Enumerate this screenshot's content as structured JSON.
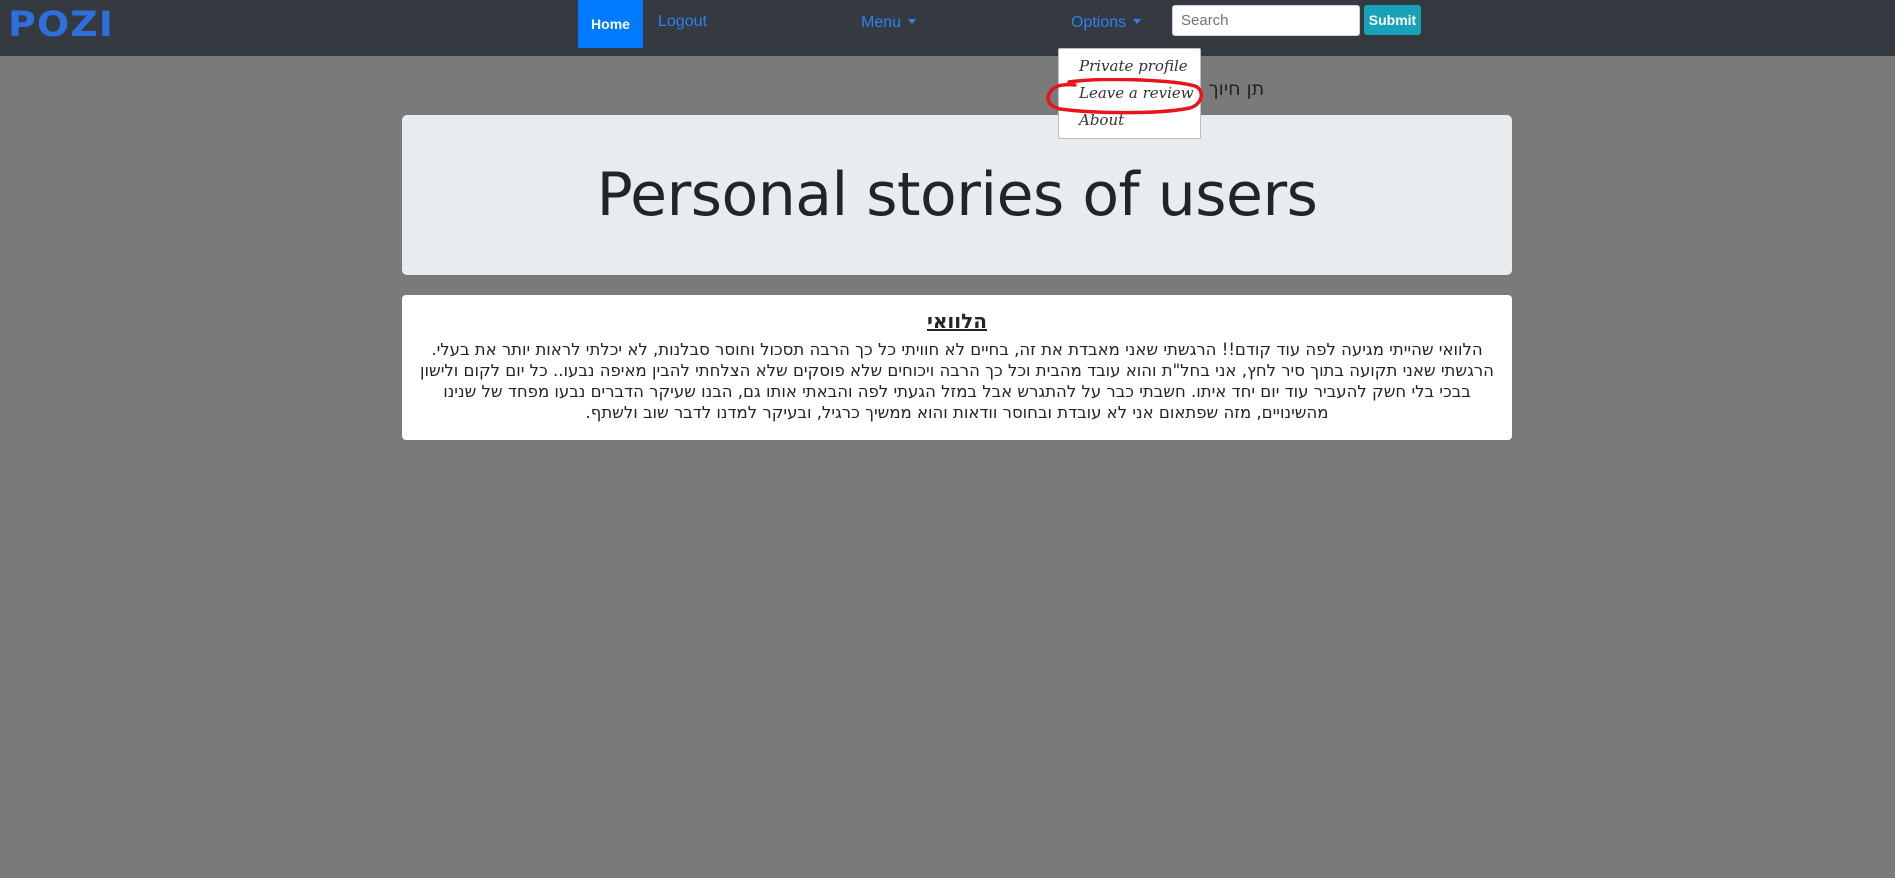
{
  "navbar": {
    "logo_text": "POZI",
    "home_label": "Home",
    "logout_label": "Logout",
    "menu_label": "Menu",
    "options_label": "Options",
    "search_placeholder": "Search",
    "submit_label": "Submit"
  },
  "dropdown": {
    "items": [
      {
        "label": "Private profile"
      },
      {
        "label": "Leave a review"
      },
      {
        "label": "About"
      }
    ]
  },
  "partial_text": "תן חיוך ה",
  "jumbotron": {
    "title": "Personal stories of users"
  },
  "story": {
    "title": "הלוואי",
    "body": "הלוואי שהייתי מגיעה לפה עוד קודם!! הרגשתי שאני מאבדת את זה, בחיים לא חוויתי כל כך הרבה תסכול וחוסר סבלנות, לא יכלתי לראות יותר את בעלי. הרגשתי שאני תקועה בתוך סיר לחץ, אני בחל\"ת והוא עובד מהבית וכל כך הרבה ויכוחים שלא פוסקים שלא הצלחתי להבין מאיפה נבעו.. כל יום לקום ולישון בבכי בלי חשק להעביר עוד יום יחד איתו. חשבתי כבר על להתגרש אבל במזל הגעתי לפה והבאתי אותו גם, הבנו שעיקר הדברים נבעו מפחד של שנינו מהשינויים, מזה שפתאום אני לא עובדת ובחוסר וודאות והוא ממשיך כרגיל, ובעיקר למדנו לדבר שוב ולשתף."
  },
  "colors": {
    "navbar_bg": "#343a40",
    "accent": "#007bff",
    "submit": "#17a2b8",
    "overlay_bg": "#7a7a7a",
    "annotation": "#e8141b"
  }
}
